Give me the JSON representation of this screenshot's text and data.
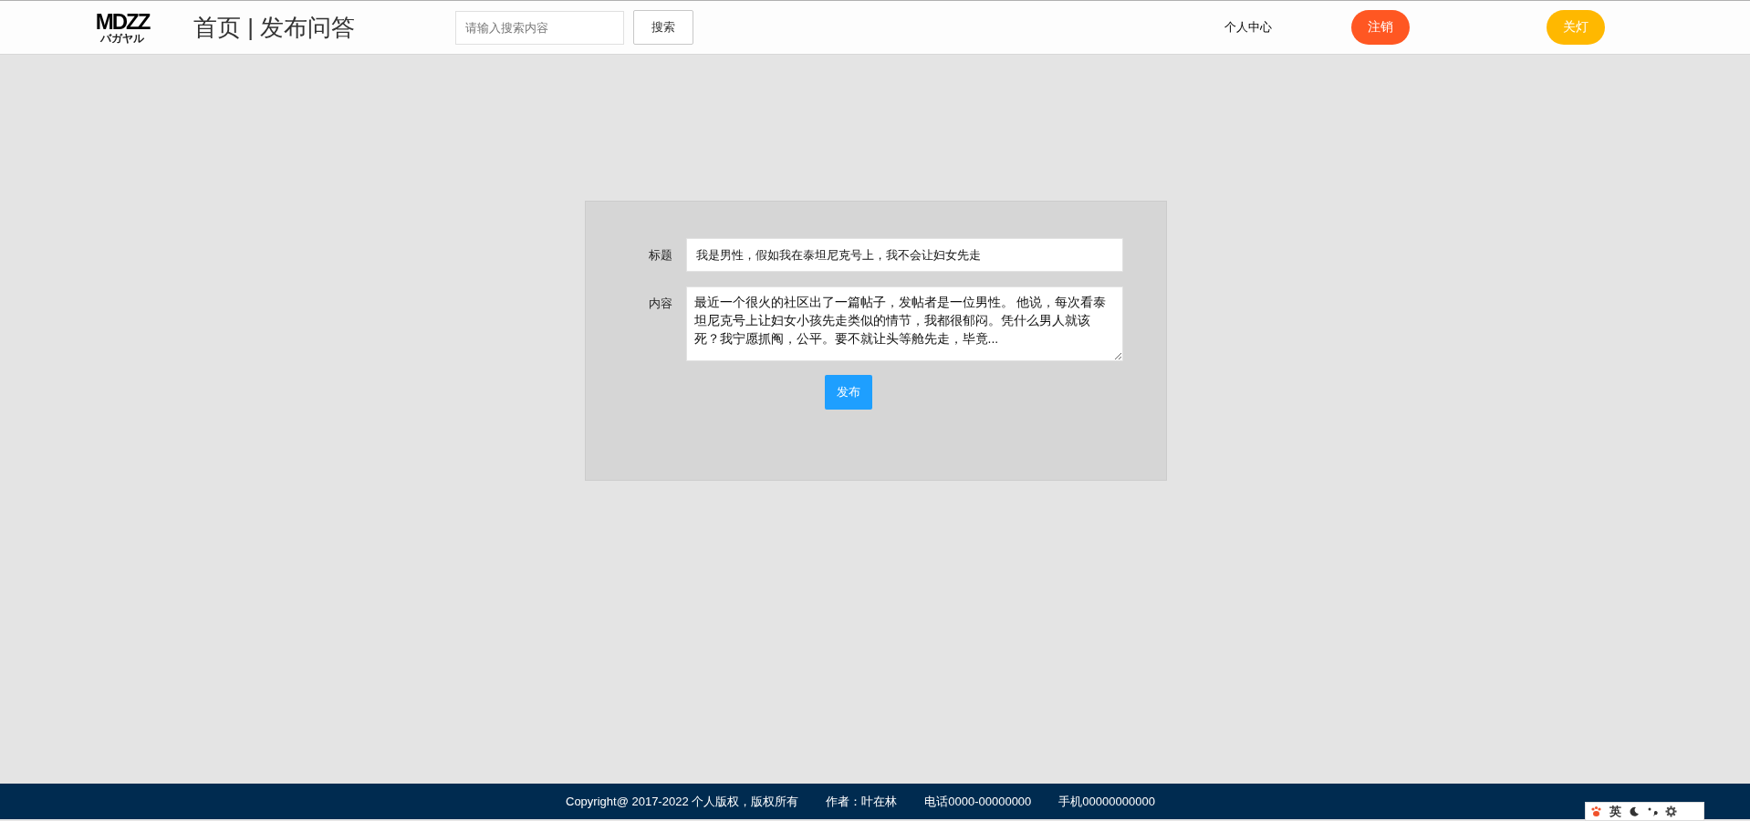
{
  "header": {
    "logo": {
      "text": "MDZZ",
      "subtext": "バガヤル"
    },
    "title": "首页 | 发布问答",
    "search": {
      "placeholder": "请输入搜索内容",
      "button": "搜索"
    },
    "user_link": "个人中心",
    "logout_button": "注销",
    "lights_button": "关灯"
  },
  "form": {
    "fields": [
      {
        "kind": "input",
        "label": "标题",
        "value": "我是男性，假如我在泰坦尼克号上，我不会让妇女先走"
      },
      {
        "kind": "textarea",
        "label": "内容",
        "value": "最近一个很火的社区出了一篇帖子，发帖者是一位男性。 他说，每次看泰坦尼克号上让妇女小孩先走类似的情节，我都很郁闷。凭什么男人就该死？我宁愿抓阄，公平。要不就让头等舱先走，毕竟..."
      }
    ],
    "submit": "发布"
  },
  "footer": [
    "Copyright@ 2017-2022 个人版权，版权所有",
    "作者：叶在林",
    "电话0000-00000000",
    "手机00000000000"
  ],
  "ime_toolbar": {
    "label": "英"
  }
}
